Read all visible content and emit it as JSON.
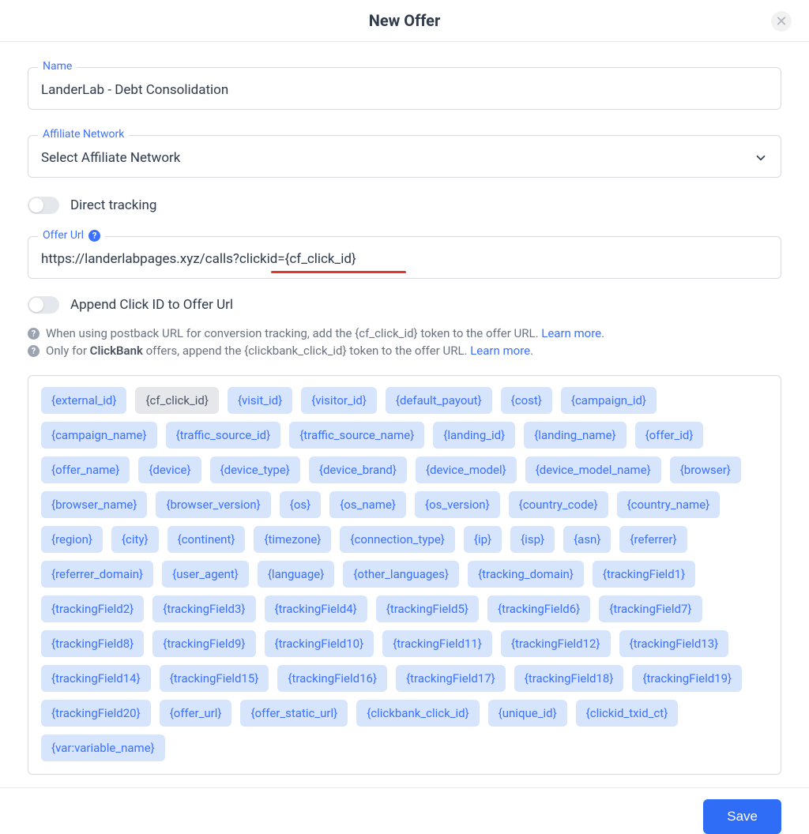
{
  "header": {
    "title": "New Offer"
  },
  "fields": {
    "name": {
      "label": "Name",
      "value": "LanderLab - Debt Consolidation"
    },
    "affiliate_network": {
      "label": "Affiliate Network",
      "placeholder": "Select Affiliate Network"
    },
    "direct_tracking_label": "Direct tracking",
    "offer_url": {
      "label": "Offer Url",
      "value": "https://landerlabpages.xyz/calls?clickid={cf_click_id}"
    },
    "append_click_id_label": "Append Click ID to Offer Url"
  },
  "info": {
    "line1": {
      "text": "When using postback URL for conversion tracking, add the {cf_click_id} token to the offer URL. ",
      "link": "Learn more",
      "suffix": "."
    },
    "line2": {
      "prefix": "Only for ",
      "bold": "ClickBank",
      "text": " offers, append the {clickbank_click_id} token to the offer URL. ",
      "link": "Learn more",
      "suffix": "."
    }
  },
  "tokens": [
    {
      "t": "{external_id}",
      "d": false
    },
    {
      "t": "{cf_click_id}",
      "d": true
    },
    {
      "t": "{visit_id}",
      "d": false
    },
    {
      "t": "{visitor_id}",
      "d": false
    },
    {
      "t": "{default_payout}",
      "d": false
    },
    {
      "t": "{cost}",
      "d": false
    },
    {
      "t": "{campaign_id}",
      "d": false
    },
    {
      "t": "{campaign_name}",
      "d": false
    },
    {
      "t": "{traffic_source_id}",
      "d": false
    },
    {
      "t": "{traffic_source_name}",
      "d": false
    },
    {
      "t": "{landing_id}",
      "d": false
    },
    {
      "t": "{landing_name}",
      "d": false
    },
    {
      "t": "{offer_id}",
      "d": false
    },
    {
      "t": "{offer_name}",
      "d": false
    },
    {
      "t": "{device}",
      "d": false
    },
    {
      "t": "{device_type}",
      "d": false
    },
    {
      "t": "{device_brand}",
      "d": false
    },
    {
      "t": "{device_model}",
      "d": false
    },
    {
      "t": "{device_model_name}",
      "d": false
    },
    {
      "t": "{browser}",
      "d": false
    },
    {
      "t": "{browser_name}",
      "d": false
    },
    {
      "t": "{browser_version}",
      "d": false
    },
    {
      "t": "{os}",
      "d": false
    },
    {
      "t": "{os_name}",
      "d": false
    },
    {
      "t": "{os_version}",
      "d": false
    },
    {
      "t": "{country_code}",
      "d": false
    },
    {
      "t": "{country_name}",
      "d": false
    },
    {
      "t": "{region}",
      "d": false
    },
    {
      "t": "{city}",
      "d": false
    },
    {
      "t": "{continent}",
      "d": false
    },
    {
      "t": "{timezone}",
      "d": false
    },
    {
      "t": "{connection_type}",
      "d": false
    },
    {
      "t": "{ip}",
      "d": false
    },
    {
      "t": "{isp}",
      "d": false
    },
    {
      "t": "{asn}",
      "d": false
    },
    {
      "t": "{referrer}",
      "d": false
    },
    {
      "t": "{referrer_domain}",
      "d": false
    },
    {
      "t": "{user_agent}",
      "d": false
    },
    {
      "t": "{language}",
      "d": false
    },
    {
      "t": "{other_languages}",
      "d": false
    },
    {
      "t": "{tracking_domain}",
      "d": false
    },
    {
      "t": "{trackingField1}",
      "d": false
    },
    {
      "t": "{trackingField2}",
      "d": false
    },
    {
      "t": "{trackingField3}",
      "d": false
    },
    {
      "t": "{trackingField4}",
      "d": false
    },
    {
      "t": "{trackingField5}",
      "d": false
    },
    {
      "t": "{trackingField6}",
      "d": false
    },
    {
      "t": "{trackingField7}",
      "d": false
    },
    {
      "t": "{trackingField8}",
      "d": false
    },
    {
      "t": "{trackingField9}",
      "d": false
    },
    {
      "t": "{trackingField10}",
      "d": false
    },
    {
      "t": "{trackingField11}",
      "d": false
    },
    {
      "t": "{trackingField12}",
      "d": false
    },
    {
      "t": "{trackingField13}",
      "d": false
    },
    {
      "t": "{trackingField14}",
      "d": false
    },
    {
      "t": "{trackingField15}",
      "d": false
    },
    {
      "t": "{trackingField16}",
      "d": false
    },
    {
      "t": "{trackingField17}",
      "d": false
    },
    {
      "t": "{trackingField18}",
      "d": false
    },
    {
      "t": "{trackingField19}",
      "d": false
    },
    {
      "t": "{trackingField20}",
      "d": false
    },
    {
      "t": "{offer_url}",
      "d": false
    },
    {
      "t": "{offer_static_url}",
      "d": false
    },
    {
      "t": "{clickbank_click_id}",
      "d": false
    },
    {
      "t": "{unique_id}",
      "d": false
    },
    {
      "t": "{clickid_txid_ct}",
      "d": false
    },
    {
      "t": "{var:variable_name}",
      "d": false
    }
  ],
  "footer": {
    "save_label": "Save"
  }
}
